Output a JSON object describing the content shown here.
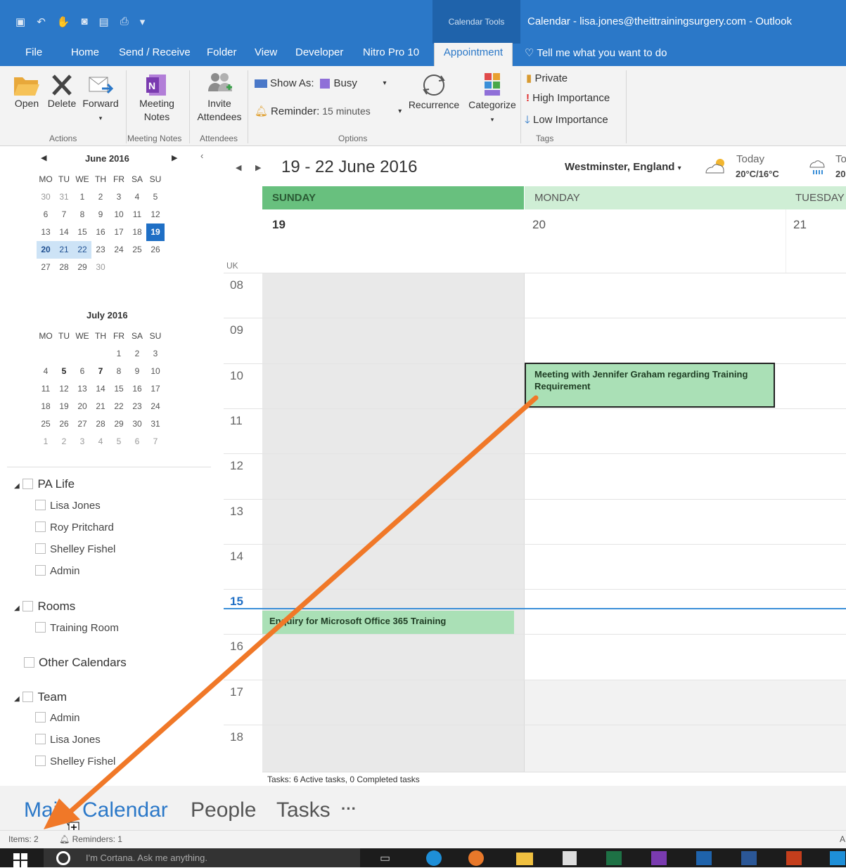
{
  "window": {
    "title": "Calendar - lisa.jones@theittrainingsurgery.com - Outlook",
    "context_tab_header": "Calendar Tools"
  },
  "menu": {
    "tabs": [
      "File",
      "Home",
      "Send / Receive",
      "Folder",
      "View",
      "Developer",
      "Nitro Pro 10"
    ],
    "active_tab": "Appointment",
    "tell_me": "Tell me what you want to do"
  },
  "ribbon": {
    "open": "Open",
    "delete": "Delete",
    "forward": "Forward",
    "meeting_notes_line1": "Meeting",
    "meeting_notes_line2": "Notes",
    "invite_line1": "Invite",
    "invite_line2": "Attendees",
    "show_as_label": "Show As:",
    "show_as_value": "Busy",
    "reminder_label": "Reminder:",
    "reminder_value": "15 minutes",
    "recurrence": "Recurrence",
    "categorize": "Categorize",
    "private": "Private",
    "high_importance": "High Importance",
    "low_importance": "Low Importance",
    "groups": {
      "actions": "Actions",
      "meeting_notes": "Meeting Notes",
      "attendees": "Attendees",
      "options": "Options",
      "tags": "Tags"
    }
  },
  "minicals": [
    {
      "title": "June 2016",
      "days_header": [
        "MO",
        "TU",
        "WE",
        "TH",
        "FR",
        "SA",
        "SU"
      ],
      "days": [
        "30",
        "31",
        "1",
        "2",
        "3",
        "4",
        "5",
        "6",
        "7",
        "8",
        "9",
        "10",
        "11",
        "12",
        "13",
        "14",
        "15",
        "16",
        "17",
        "18",
        "19",
        "20",
        "21",
        "22",
        "23",
        "24",
        "25",
        "26",
        "27",
        "28",
        "29",
        "30",
        "",
        "",
        ""
      ]
    },
    {
      "title": "July 2016",
      "days_header": [
        "MO",
        "TU",
        "WE",
        "TH",
        "FR",
        "SA",
        "SU"
      ],
      "days": [
        "",
        "",
        "",
        "",
        "1",
        "2",
        "3",
        "4",
        "5",
        "6",
        "7",
        "8",
        "9",
        "10",
        "11",
        "12",
        "13",
        "14",
        "15",
        "16",
        "17",
        "18",
        "19",
        "20",
        "21",
        "22",
        "23",
        "24",
        "25",
        "26",
        "27",
        "28",
        "29",
        "30",
        "31",
        "1",
        "2",
        "3",
        "4",
        "5",
        "6",
        "7"
      ]
    }
  ],
  "folders": [
    {
      "name": "PA Life",
      "items": [
        "Lisa Jones",
        "Roy Pritchard",
        "Shelley Fishel",
        "Admin"
      ]
    },
    {
      "name": "Rooms",
      "items": [
        "Training Room"
      ]
    },
    {
      "name": "Other Calendars",
      "items": []
    },
    {
      "name": "Team",
      "items": [
        "Admin",
        "Lisa Jones",
        "Shelley Fishel"
      ]
    }
  ],
  "calendar": {
    "date_range": "19 - 22 June 2016",
    "location": "Westminster, England",
    "weather_today_label": "Today",
    "weather_today_temp": "20°C/16°C",
    "weather_next_label": "To",
    "weather_next_temp": "20",
    "days": [
      {
        "name": "SUNDAY",
        "num": "19"
      },
      {
        "name": "MONDAY",
        "num": "20"
      },
      {
        "name": "TUESDAY",
        "num": "21"
      }
    ],
    "timezone": "UK",
    "hours": [
      "08",
      "09",
      "10",
      "11",
      "12",
      "13",
      "14",
      "15",
      "16",
      "17",
      "18"
    ],
    "appointments": [
      {
        "title": "Meeting with Jennifer Graham regarding Training Requirement"
      },
      {
        "title": "Enquiry for Microsoft Office 365 Training"
      }
    ],
    "tasks_summary": "Tasks: 6 Active tasks, 0 Completed tasks"
  },
  "bottom_nav": {
    "mail": "Mail",
    "calendar": "Calendar",
    "people": "People",
    "tasks": "Tasks",
    "more": "···"
  },
  "status": {
    "items": "Items: 2",
    "reminders": "Reminders: 1",
    "right_hint": "A"
  },
  "taskbar": {
    "search_placeholder": "I'm Cortana. Ask me anything."
  },
  "colors": {
    "accent": "#2b78c8",
    "green": "#68c07e",
    "arrow": "#f07828"
  }
}
